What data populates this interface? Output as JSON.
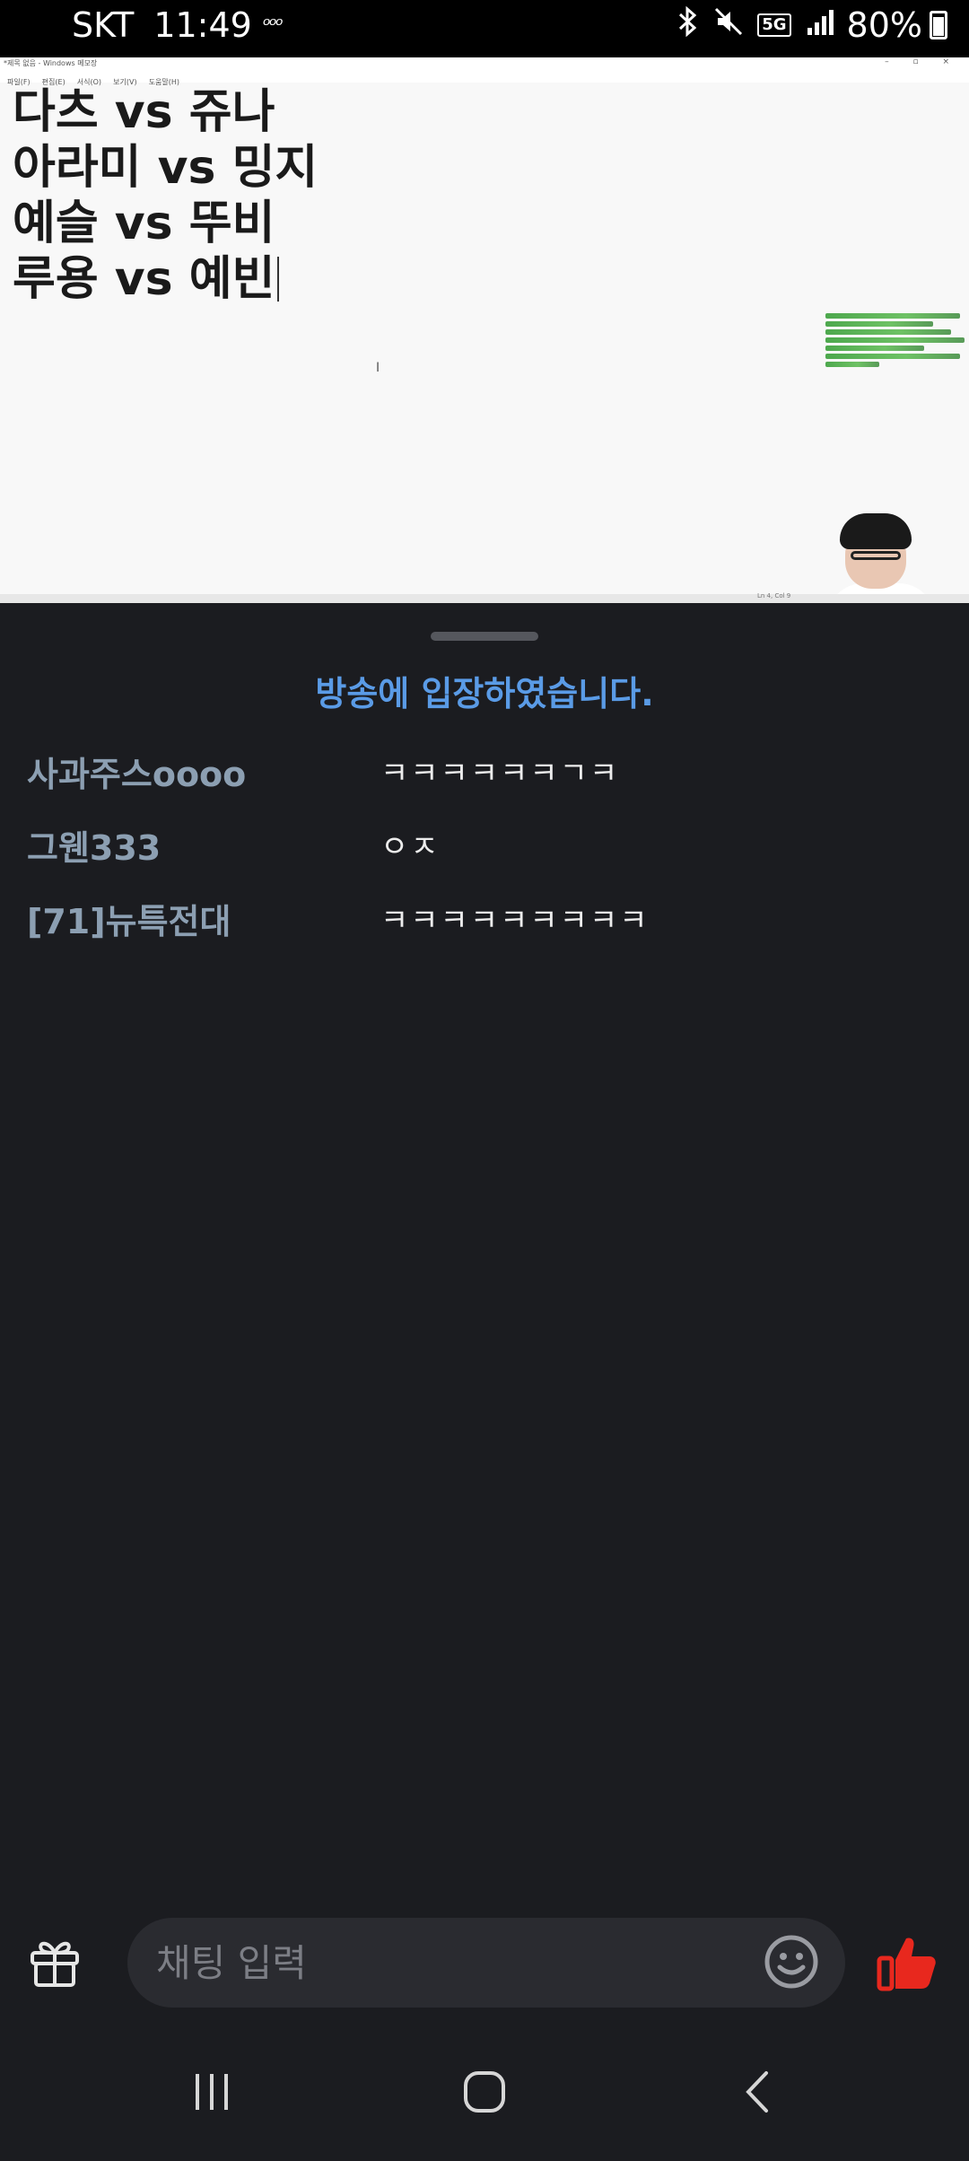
{
  "status_bar": {
    "carrier": "SKT",
    "time": "11:49",
    "net_indicator": "ᵒᵒᵒ",
    "five_g": "5G",
    "battery": "80%",
    "battery_level": 0.8,
    "icons": [
      "bluetooth-icon",
      "mute-icon",
      "5g-icon",
      "signal-icon",
      "battery-icon"
    ]
  },
  "stream": {
    "window_title": "*제목 없음 - Windows 메모장",
    "menu": [
      "파일(F)",
      "편집(E)",
      "서식(O)",
      "보기(V)",
      "도움말(H)"
    ],
    "window_buttons": "– ▫ ×",
    "lines": [
      "다츠 vs 쥬나",
      "아라미 vs 밍지",
      "예슬 vs 뚜비",
      "루용 vs 예빈"
    ],
    "status_text": "Ln 4, Col 9"
  },
  "chat": {
    "notice": "방송에 입장하였습니다.",
    "messages": [
      {
        "user": "사과주스oooo",
        "text": "ㅋㅋㅋㅋㅋㅋㄱㅋ"
      },
      {
        "user": "그웬333",
        "text": "ㅇㅈ"
      },
      {
        "user": "[71]뉴특전대",
        "text": "ㅋㅋㅋㅋㅋㅋㅋㅋㅋ"
      }
    ]
  },
  "input": {
    "placeholder": "채팅 입력"
  },
  "colors": {
    "panel_bg": "#1b1c20",
    "notice": "#5a9be6",
    "username": "#8c9fb2",
    "like": "#e8281e"
  }
}
